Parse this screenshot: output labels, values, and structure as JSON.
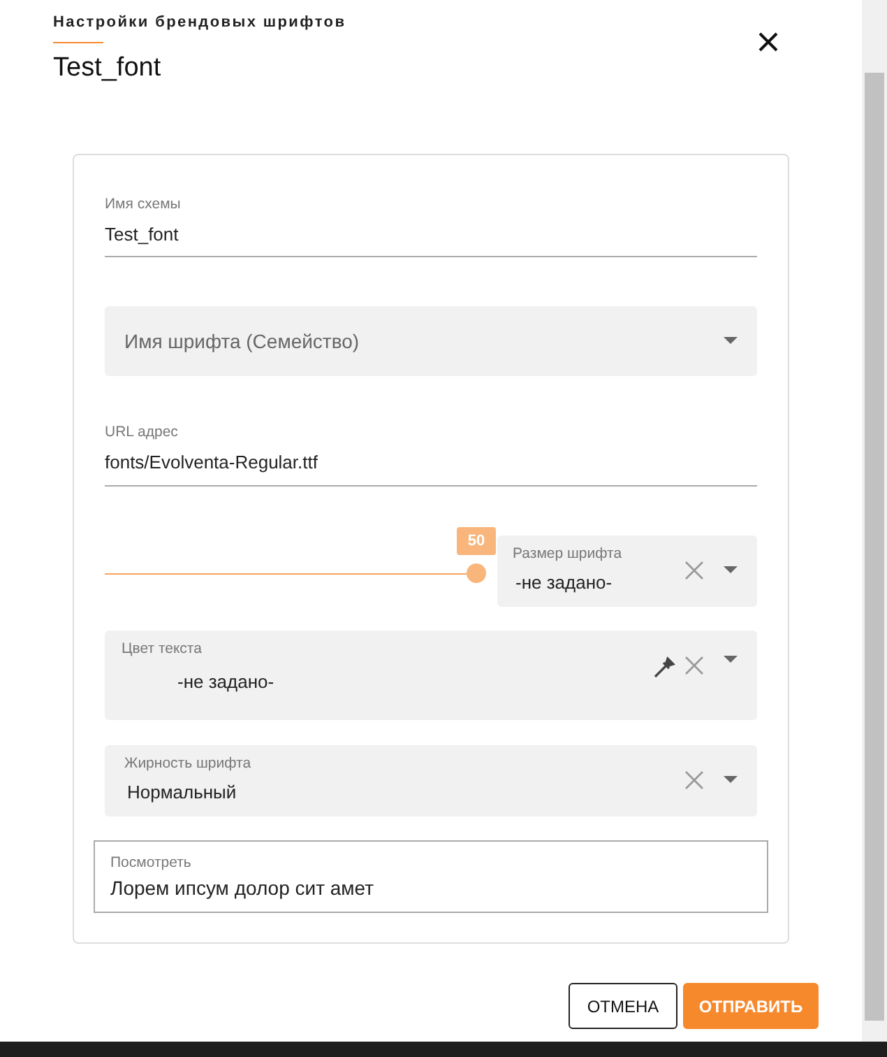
{
  "dialog": {
    "subtitle": "Настройки брендовых шрифтов",
    "title": "Test_font"
  },
  "fields": [
    {
      "kind": "text",
      "label": "Имя схемы",
      "value": "Test_font"
    },
    {
      "kind": "select",
      "placeholder": "Имя шрифта (Семейство)"
    },
    {
      "kind": "text",
      "label": "URL адрес",
      "value": "fonts/Evolventa-Regular.ttf"
    },
    {
      "kind": "size",
      "slider": {
        "level": 1,
        "reading": "50"
      },
      "label": "Размер шрифта",
      "value": "-не задано-"
    },
    {
      "kind": "color",
      "label": "Цвет текста",
      "value": "-не задано-"
    },
    {
      "kind": "select",
      "label": "Жирность шрифта",
      "value": "Нормальный"
    },
    {
      "kind": "preview",
      "label": "Посмотреть",
      "value": "Лорем ипсум долор сит амет"
    }
  ],
  "buttons": [
    {
      "label": "ОТМЕНА",
      "kind": "secondary"
    },
    {
      "label": "ОТПРАВИТЬ",
      "kind": "primary"
    }
  ]
}
